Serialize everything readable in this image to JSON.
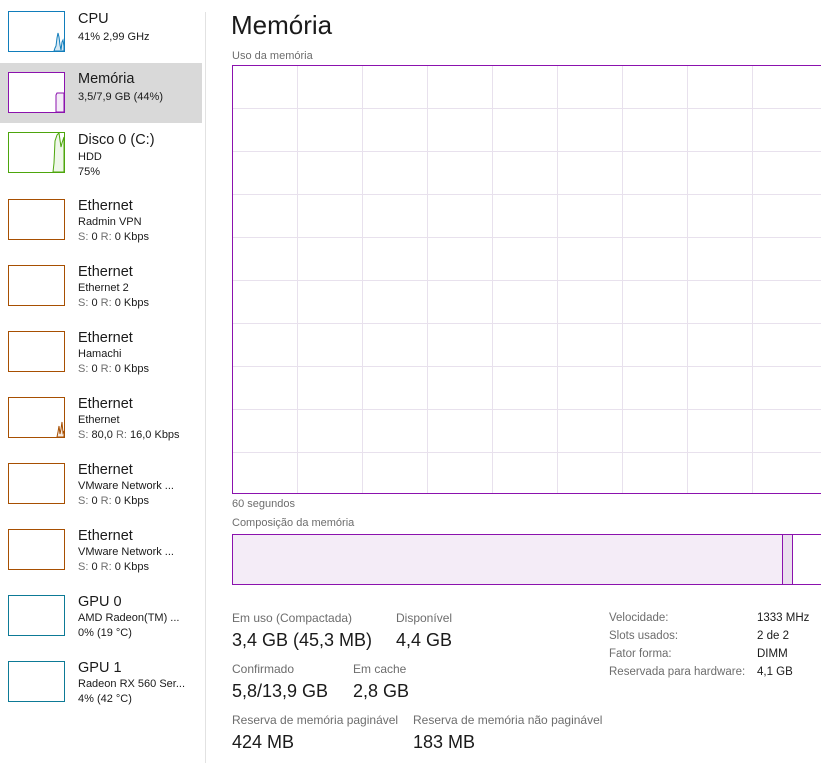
{
  "sidebar": {
    "items": [
      {
        "title": "CPU",
        "line1": "41% 2,99 GHz",
        "line2": "",
        "color": "#117dbb",
        "selected": false
      },
      {
        "title": "Memória",
        "line1": "3,5/7,9 GB (44%)",
        "line2": "",
        "color": "#8b12ae",
        "selected": true
      },
      {
        "title": "Disco 0 (C:)",
        "line1": "HDD",
        "line2": "75%",
        "color": "#4da60c",
        "selected": false
      },
      {
        "title": "Ethernet",
        "line1": "Radmin VPN",
        "line2_send_label": "S:",
        "line2_send": "0",
        "line2_recv_label": "R:",
        "line2_recv": "0 Kbps",
        "color": "#a74f01",
        "selected": false
      },
      {
        "title": "Ethernet",
        "line1": "Ethernet 2",
        "line2_send_label": "S:",
        "line2_send": "0",
        "line2_recv_label": "R:",
        "line2_recv": "0 Kbps",
        "color": "#a74f01",
        "selected": false
      },
      {
        "title": "Ethernet",
        "line1": "Hamachi",
        "line2_send_label": "S:",
        "line2_send": "0",
        "line2_recv_label": "R:",
        "line2_recv": "0 Kbps",
        "color": "#a74f01",
        "selected": false
      },
      {
        "title": "Ethernet",
        "line1": "Ethernet",
        "line2_send_label": "S:",
        "line2_send": "80,0",
        "line2_recv_label": "R:",
        "line2_recv": "16,0 Kbps",
        "color": "#a74f01",
        "selected": false
      },
      {
        "title": "Ethernet",
        "line1": "VMware Network ...",
        "line2_send_label": "S:",
        "line2_send": "0",
        "line2_recv_label": "R:",
        "line2_recv": "0 Kbps",
        "color": "#a74f01",
        "selected": false
      },
      {
        "title": "Ethernet",
        "line1": "VMware Network ...",
        "line2_send_label": "S:",
        "line2_send": "0",
        "line2_recv_label": "R:",
        "line2_recv": "0 Kbps",
        "color": "#a74f01",
        "selected": false
      },
      {
        "title": "GPU 0",
        "line1": "AMD Radeon(TM) ...",
        "line2": "0% (19 °C)",
        "color": "#0d7a96",
        "selected": false
      },
      {
        "title": "GPU 1",
        "line1": "Radeon RX 560 Ser...",
        "line2": "4% (42 °C)",
        "color": "#0d7a96",
        "selected": false
      }
    ]
  },
  "main": {
    "title": "Memória",
    "usage_label": "Uso da memória",
    "time_label": "60 segundos",
    "composition_label": "Composição da memória",
    "accent_color": "#8b12ae",
    "stats": {
      "in_use_label": "Em uso (Compactada)",
      "in_use_value": "3,4 GB (45,3 MB)",
      "available_label": "Disponível",
      "available_value": "4,4 GB",
      "committed_label": "Confirmado",
      "committed_value": "5,8/13,9 GB",
      "cached_label": "Em cache",
      "cached_value": "2,8 GB",
      "paged_label": "Reserva de memória paginável",
      "paged_value": "424 MB",
      "nonpaged_label": "Reserva de memória não paginável",
      "nonpaged_value": "183 MB"
    },
    "specs": {
      "speed_label": "Velocidade:",
      "speed_value": "1333 MHz",
      "slots_label": "Slots usados:",
      "slots_value": "2 de 2",
      "form_label": "Fator forma:",
      "form_value": "DIMM",
      "reserved_label": "Reservada para hardware:",
      "reserved_value": "4,1 GB"
    }
  }
}
